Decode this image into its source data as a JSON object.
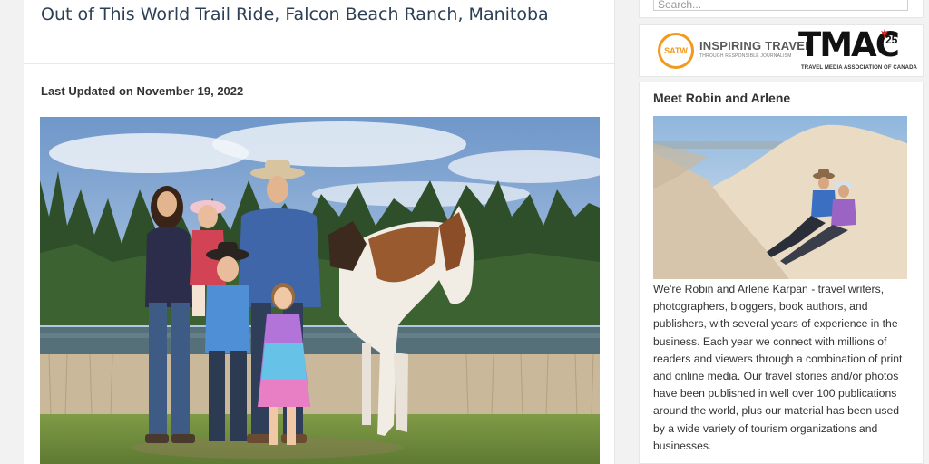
{
  "article": {
    "title": "Out of This World Trail Ride, Falcon Beach Ranch, Manitoba",
    "last_updated": "Last Updated on November 19, 2022",
    "hero_image": "family-with-horse-photo"
  },
  "sidebar": {
    "search": {
      "placeholder": "Search..."
    },
    "logos": {
      "satw": "SATW",
      "inspiring_travel": "INSPIRING TRAVEL",
      "inspiring_sub": "THROUGH RESPONSIBLE JOURNALISM",
      "tmac": "TMAC",
      "tmac_25": "25",
      "tmac_sub": "TRAVEL MEDIA ASSOCIATION OF CANADA"
    },
    "meet": {
      "title": "Meet Robin and Arlene",
      "photo": "couple-on-sand-dune-photo",
      "bio": "We're Robin and Arlene Karpan - travel writers, photographers, bloggers, book authors, and publishers, with several years of experience in the business. Each year we connect with millions of readers and viewers through a combination of print and online media. Our travel stories and/or photos have been published in well over 100 publications around the world, plus our material has been used by a wide variety of tourism organizations and businesses."
    }
  },
  "colors": {
    "title": "#2d3f55",
    "satw_orange": "#f39a1e",
    "maple_red": "#d52b1e"
  }
}
